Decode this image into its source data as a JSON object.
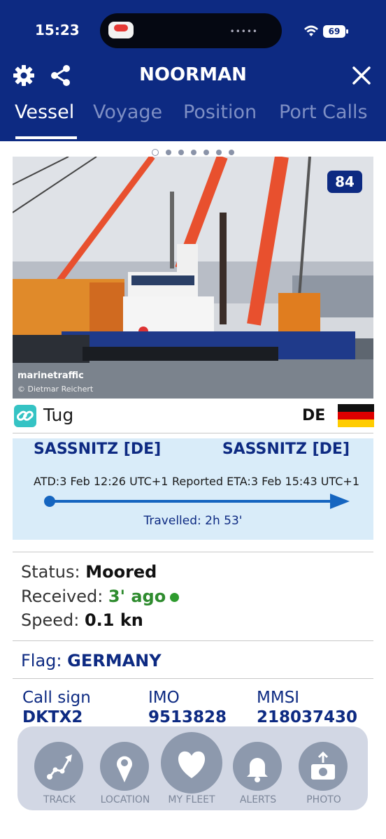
{
  "status_bar": {
    "time": "15:23",
    "battery": "69"
  },
  "header": {
    "title": "NOORMAN",
    "tabs": [
      {
        "label": "Vessel",
        "active": true
      },
      {
        "label": "Voyage",
        "active": false
      },
      {
        "label": "Position",
        "active": false
      },
      {
        "label": "Port Calls",
        "active": false
      }
    ]
  },
  "pager": {
    "count": 7,
    "active_index": 0
  },
  "photo": {
    "badge": "84",
    "brand": "marinetraffic",
    "credit": "© Dietmar Reichert"
  },
  "vessel": {
    "type": "Tug",
    "country_code": "DE",
    "flag_colors": [
      "#111111",
      "#dd0000",
      "#ffcc00"
    ]
  },
  "voyage": {
    "from": "SASSNITZ [DE]",
    "to": "SASSNITZ [DE]",
    "atd_label": "ATD:",
    "atd_value": "3 Feb 12:26 UTC+1",
    "eta_label": "Reported ETA:",
    "eta_value": "3 Feb 15:43 UTC+1",
    "travelled": "Travelled: 2h 53'"
  },
  "status": {
    "status_label": "Status:",
    "status_value": "Moored",
    "received_label": "Received:",
    "received_value": "3' ago",
    "speed_label": "Speed:",
    "speed_value": "0.1 kn"
  },
  "flag_row": {
    "label": "Flag:",
    "value": "GERMANY"
  },
  "identifiers": [
    {
      "label": "Call sign",
      "value": "DKTX2"
    },
    {
      "label": "IMO",
      "value": "9513828"
    },
    {
      "label": "MMSI",
      "value": "218037430"
    }
  ],
  "bottom_bar": [
    {
      "label": "TRACK",
      "icon": "track-icon"
    },
    {
      "label": "LOCATION",
      "icon": "location-pin-icon"
    },
    {
      "label": "MY FLEET",
      "icon": "heart-icon"
    },
    {
      "label": "ALERTS",
      "icon": "bell-icon"
    },
    {
      "label": "PHOTO",
      "icon": "camera-upload-icon"
    }
  ],
  "colors": {
    "brand_navy": "#0d2a82",
    "voyage_bg": "#d9ecf9",
    "progress_blue": "#1565c0",
    "online_green": "#2e9b2e"
  }
}
